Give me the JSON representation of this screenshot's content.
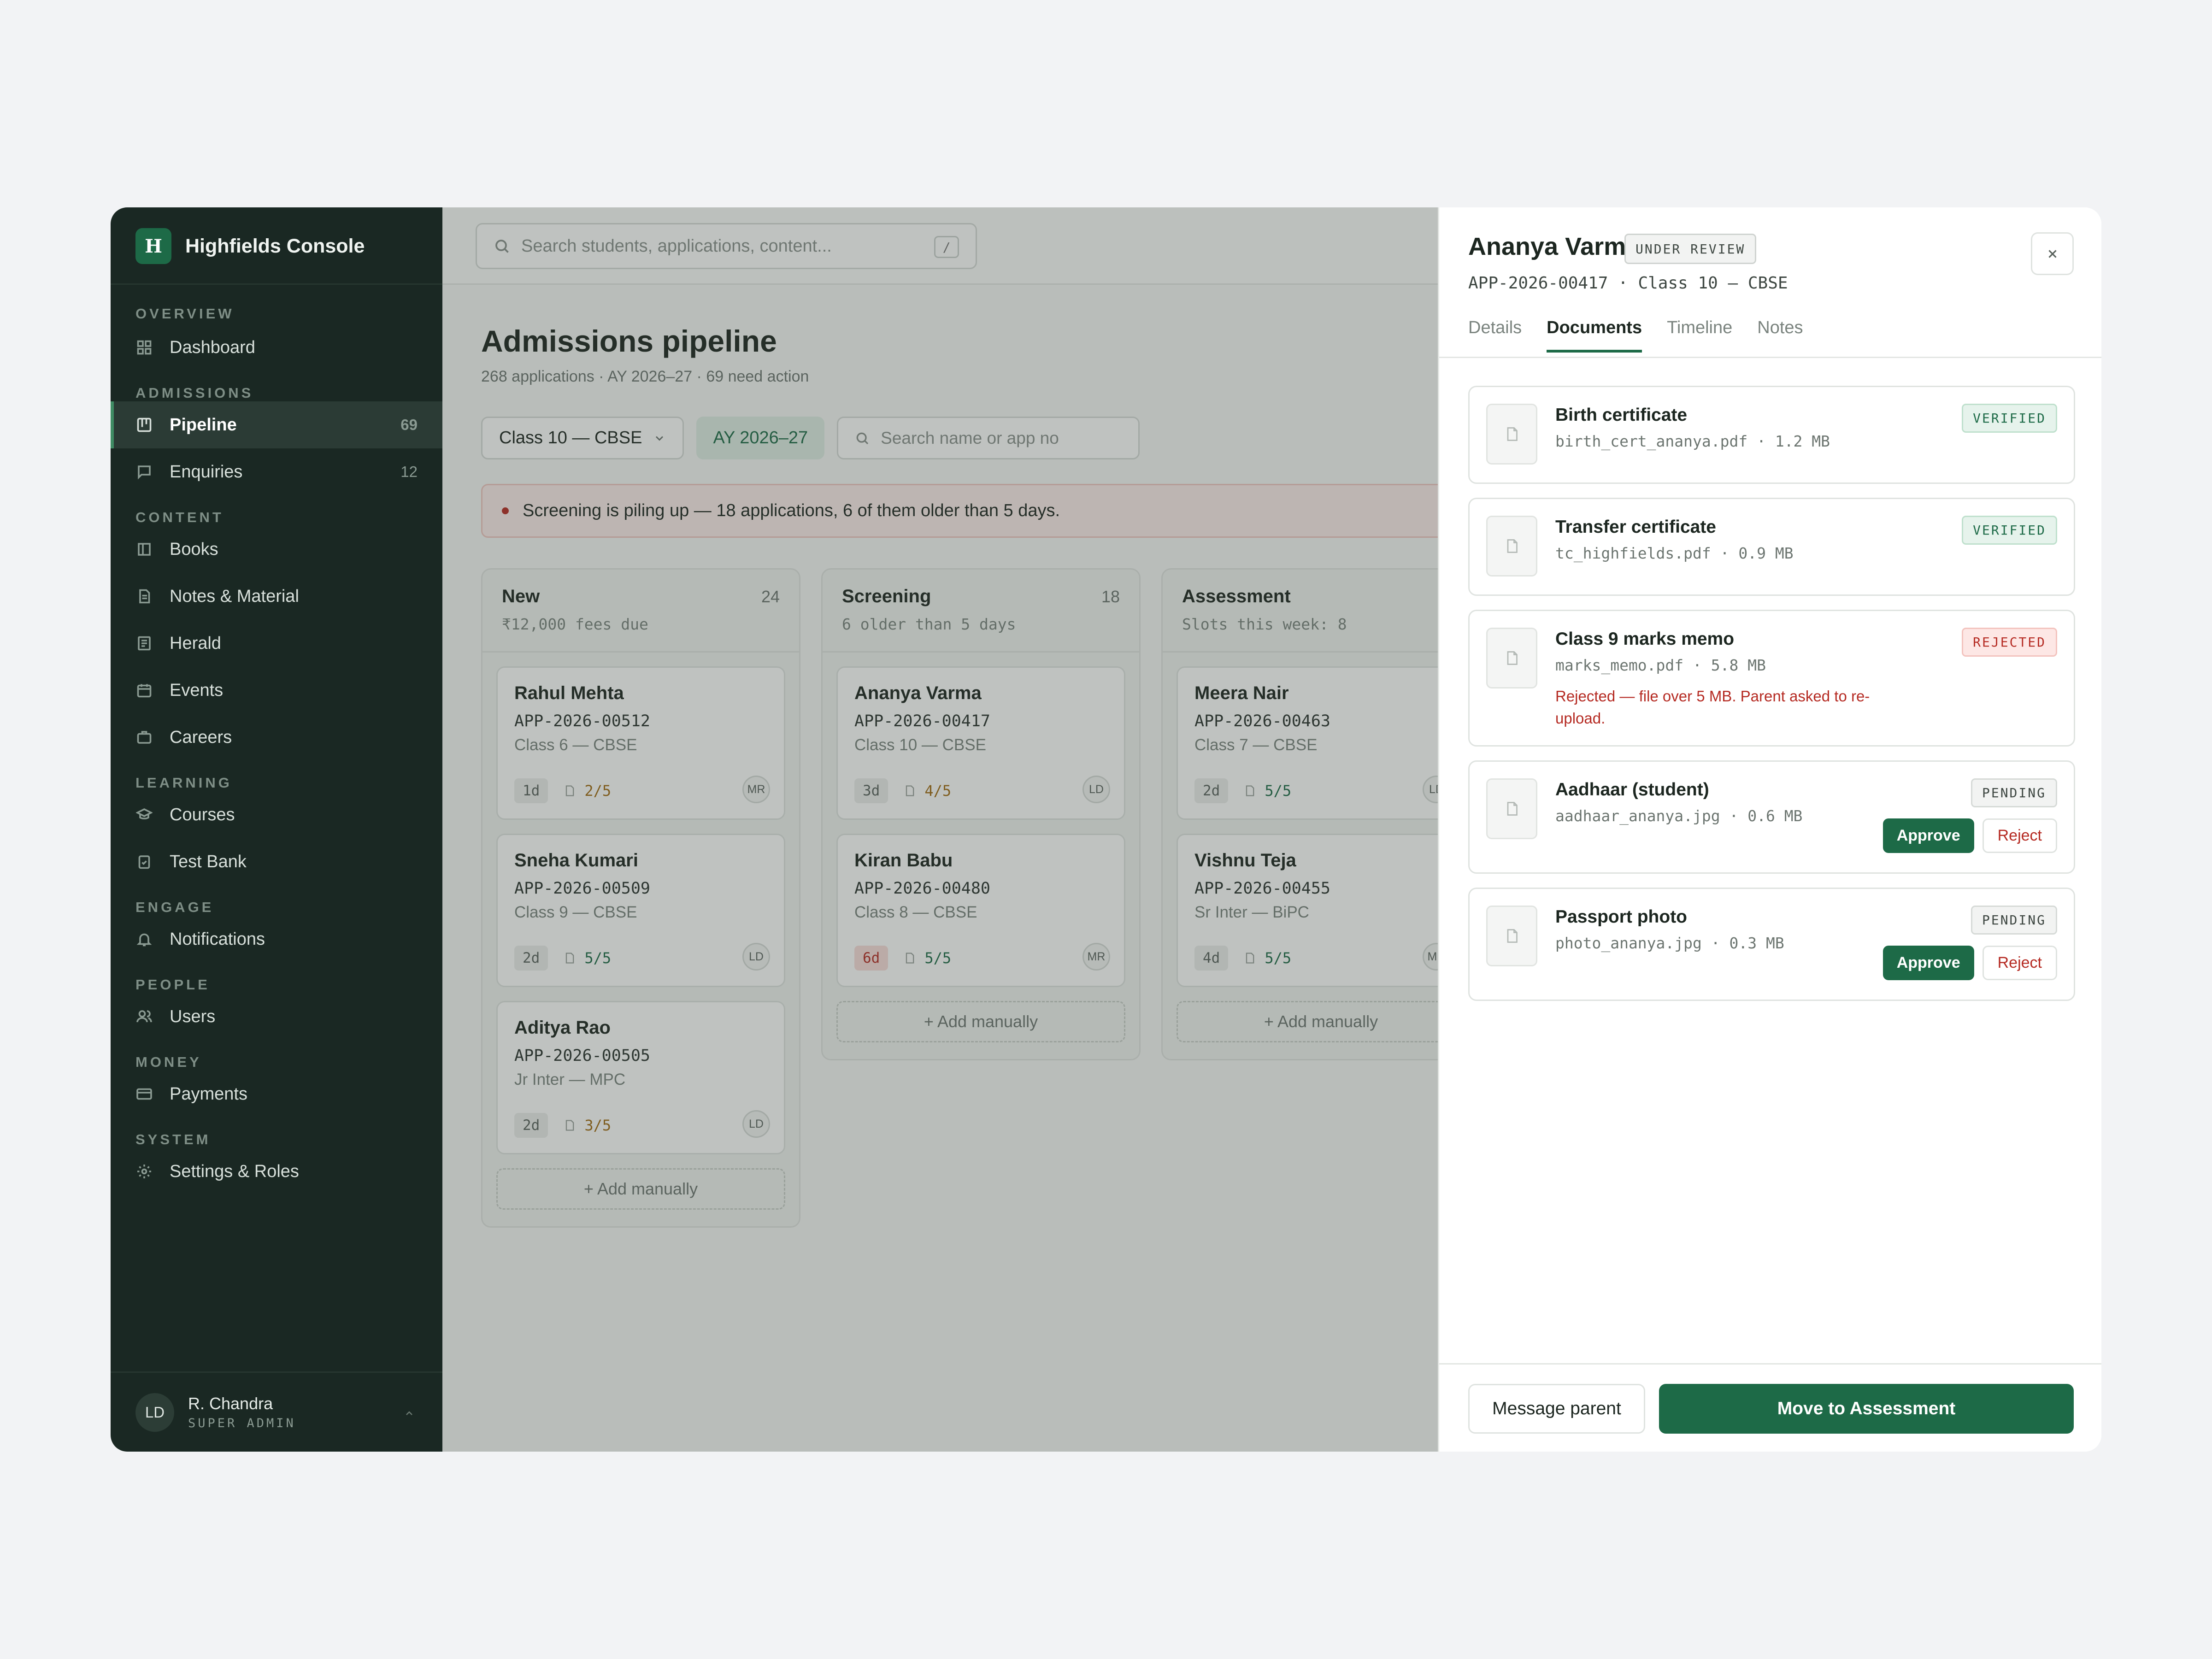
{
  "app": {
    "logo_letter": "H",
    "title": "Highfields Console"
  },
  "sidebar": {
    "sections": {
      "overview": "OVERVIEW",
      "admissions": "ADMISSIONS",
      "content": "CONTENT",
      "learning": "LEARNING",
      "engage": "ENGAGE",
      "people": "PEOPLE",
      "money": "MONEY",
      "system": "SYSTEM"
    },
    "items": {
      "dashboard": "Dashboard",
      "pipeline": "Pipeline",
      "pipeline_count": "69",
      "enquiries": "Enquiries",
      "enquiries_count": "12",
      "books": "Books",
      "notes": "Notes & Material",
      "herald": "Herald",
      "events": "Events",
      "careers": "Careers",
      "courses": "Courses",
      "testbank": "Test Bank",
      "notifications": "Notifications",
      "users": "Users",
      "payments": "Payments",
      "settings": "Settings & Roles"
    },
    "user": {
      "initials": "LD",
      "name": "R. Chandra",
      "role": "SUPER ADMIN"
    }
  },
  "topbar": {
    "search_placeholder": "Search students, applications, content...",
    "shortcut": "/"
  },
  "main": {
    "title": "Admissions pipeline",
    "subtitle": "268 applications · AY 2026–27 · 69 need action",
    "filters": {
      "class": "Class 10 — CBSE",
      "year": "AY 2026–27",
      "search_placeholder": "Search name or app no"
    },
    "alert": "Screening is piling up — 18 applications, 6 of them older than 5 days.",
    "add_label": "+ Add manually",
    "columns": [
      {
        "name": "New",
        "count": "24",
        "sub": "₹12,000 fees due",
        "cards": [
          {
            "name": "Rahul Mehta",
            "app": "APP-2026-00512",
            "cls": "Class 6 — CBSE",
            "age": "1d",
            "docs": "2/5",
            "ini": "MR"
          },
          {
            "name": "Sneha Kumari",
            "app": "APP-2026-00509",
            "cls": "Class 9 — CBSE",
            "age": "2d",
            "docs": "5/5",
            "ini": "LD"
          },
          {
            "name": "Aditya Rao",
            "app": "APP-2026-00505",
            "cls": "Jr Inter — MPC",
            "age": "2d",
            "docs": "3/5",
            "ini": "LD"
          }
        ]
      },
      {
        "name": "Screening",
        "count": "18",
        "sub": "6 older than 5 days",
        "cards": [
          {
            "name": "Ananya Varma",
            "app": "APP-2026-00417",
            "cls": "Class 10 — CBSE",
            "age": "3d",
            "docs": "4/5",
            "ini": "LD"
          },
          {
            "name": "Kiran Babu",
            "app": "APP-2026-00480",
            "cls": "Class 8 — CBSE",
            "age": "6d",
            "docs": "5/5",
            "ini": "MR"
          }
        ]
      },
      {
        "name": "Assessment",
        "count": "",
        "sub": "Slots this week: 8",
        "cards": [
          {
            "name": "Meera Nair",
            "app": "APP-2026-00463",
            "cls": "Class 7 — CBSE",
            "age": "2d",
            "docs": "5/5",
            "ini": "LD"
          },
          {
            "name": "Vishnu Teja",
            "app": "APP-2026-00455",
            "cls": "Sr Inter — BiPC",
            "age": "4d",
            "docs": "5/5",
            "ini": "MR"
          }
        ]
      }
    ]
  },
  "drawer": {
    "name": "Ananya Varma",
    "status": "UNDER REVIEW",
    "sub": "APP-2026-00417 · Class 10 — CBSE",
    "tabs": [
      "Details",
      "Documents",
      "Timeline",
      "Notes"
    ],
    "documents": [
      {
        "title": "Birth certificate",
        "file": "birth_cert_ananya.pdf · 1.2 MB",
        "status": "VERIFIED"
      },
      {
        "title": "Transfer certificate",
        "file": "tc_highfields.pdf · 0.9 MB",
        "status": "VERIFIED"
      },
      {
        "title": "Class 9 marks memo",
        "file": "marks_memo.pdf · 5.8 MB",
        "status": "REJECTED",
        "note": "Rejected — file over 5 MB. Parent asked to re-upload."
      },
      {
        "title": "Aadhaar (student)",
        "file": "aadhaar_ananya.jpg · 0.6 MB",
        "status": "PENDING"
      },
      {
        "title": "Passport photo",
        "file": "photo_ananya.jpg · 0.3 MB",
        "status": "PENDING"
      }
    ],
    "approve": "Approve",
    "reject": "Reject",
    "message_parent": "Message parent",
    "move": "Move to Assessment"
  },
  "colors": {
    "accent": "#1d6a47",
    "sidebar": "#1a2823",
    "danger": "#b52a22",
    "amber": "#a16a12"
  }
}
